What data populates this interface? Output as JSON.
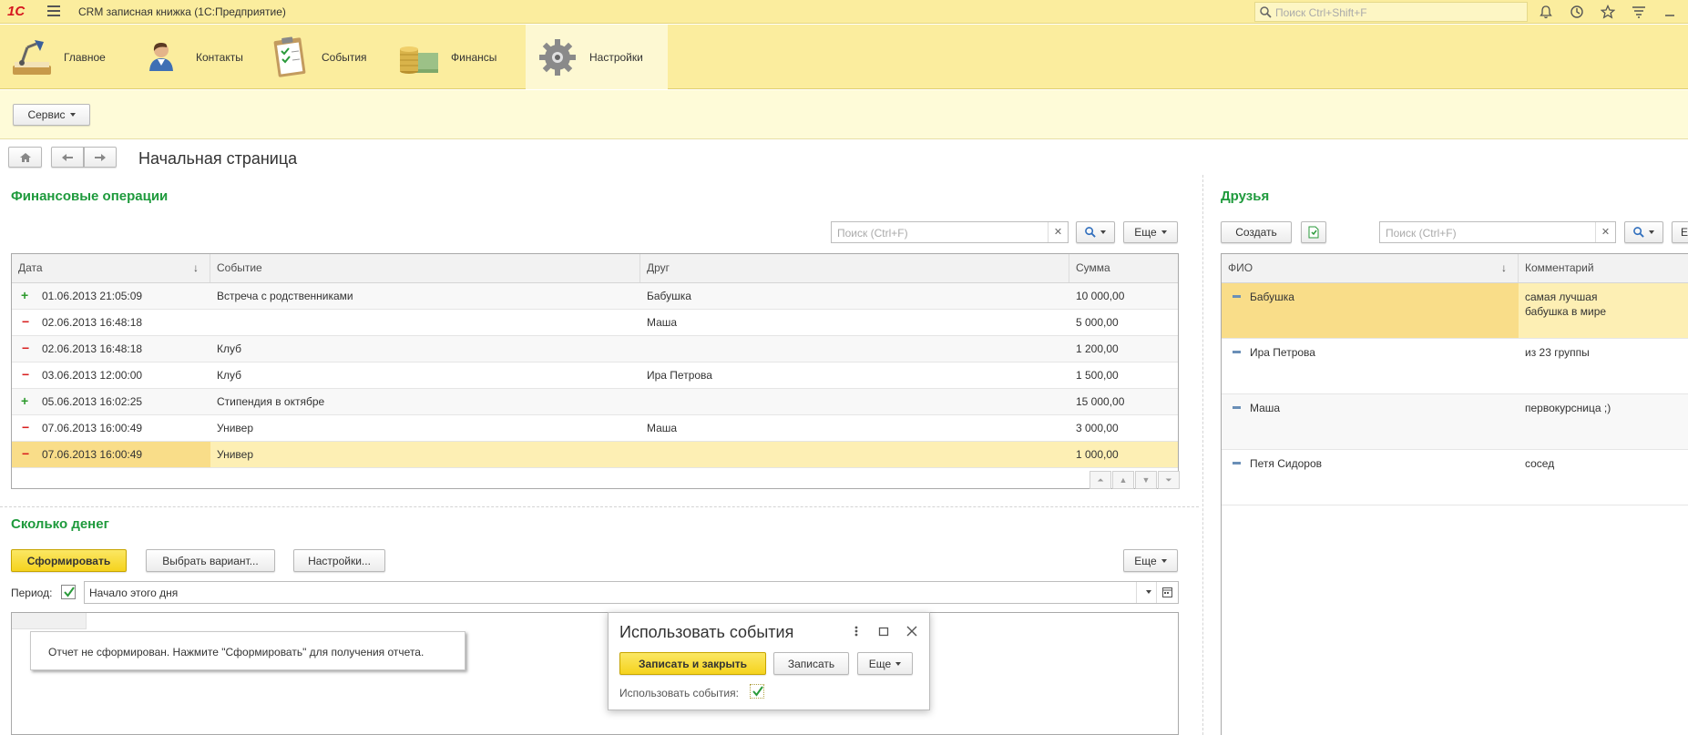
{
  "titlebar": {
    "logo": "1С",
    "title": "CRM записная книжка  (1С:Предприятие)",
    "search_placeholder": "Поиск Ctrl+Shift+F",
    "icons": [
      "bell-icon",
      "history-icon",
      "star-icon",
      "menu-lines-icon",
      "minimize-icon"
    ]
  },
  "sections": [
    {
      "label": "Главное",
      "icon": "desk-lamp-icon"
    },
    {
      "label": "Контакты",
      "icon": "person-icon"
    },
    {
      "label": "События",
      "icon": "clipboard-icon"
    },
    {
      "label": "Финансы",
      "icon": "coins-icon"
    },
    {
      "label": "Настройки",
      "icon": "gear-icon",
      "active": true
    }
  ],
  "command_bar": {
    "service_label": "Сервис"
  },
  "page": {
    "title": "Начальная страница"
  },
  "finance": {
    "title": "Финансовые операции",
    "search_placeholder": "Поиск (Ctrl+F)",
    "more_label": "Еще",
    "columns": [
      "Дата",
      "Событие",
      "Друг",
      "Сумма"
    ],
    "rows": [
      {
        "sign": "+",
        "date": "01.06.2013 21:05:09",
        "event": "Встреча с родственниками",
        "friend": "Бабушка",
        "amount": "10 000,00"
      },
      {
        "sign": "−",
        "date": "02.06.2013 16:48:18",
        "event": "",
        "friend": "Маша",
        "amount": "5 000,00"
      },
      {
        "sign": "−",
        "date": "02.06.2013 16:48:18",
        "event": "Клуб",
        "friend": "",
        "amount": "1 200,00"
      },
      {
        "sign": "−",
        "date": "03.06.2013 12:00:00",
        "event": "Клуб",
        "friend": "Ира Петрова",
        "amount": "1 500,00"
      },
      {
        "sign": "+",
        "date": "05.06.2013 16:02:25",
        "event": "Стипендия в октябре",
        "friend": "",
        "amount": "15 000,00"
      },
      {
        "sign": "−",
        "date": "07.06.2013 16:00:49",
        "event": "Универ",
        "friend": "Маша",
        "amount": "3 000,00"
      },
      {
        "sign": "−",
        "date": "07.06.2013 16:00:49",
        "event": "Универ",
        "friend": "",
        "amount": "1 000,00",
        "selected": true
      }
    ]
  },
  "money": {
    "title": "Сколько денег",
    "generate_label": "Сформировать",
    "variant_label": "Выбрать вариант...",
    "settings_label": "Настройки...",
    "more_label": "Еще",
    "period_label": "Период:",
    "period_value": "Начало этого дня",
    "report_message": "Отчет не сформирован. Нажмите \"Сформировать\" для получения отчета."
  },
  "friends": {
    "title": "Друзья",
    "create_label": "Создать",
    "search_placeholder": "Поиск (Ctrl+F)",
    "columns": [
      "ФИО",
      "Комментарий"
    ],
    "rows": [
      {
        "name": "Бабушка",
        "comment_1": "самая лучшая",
        "comment_2": "бабушка в мире",
        "selected": true
      },
      {
        "name": "Ира Петрова",
        "comment_1": "из 23 группы",
        "comment_2": ""
      },
      {
        "name": "Маша",
        "comment_1": "первокурсница ;)",
        "comment_2": ""
      },
      {
        "name": "Петя Сидоров",
        "comment_1": "сосед",
        "comment_2": ""
      }
    ]
  },
  "popup": {
    "title": "Использовать события",
    "save_close_label": "Записать и закрыть",
    "save_label": "Записать",
    "more_label": "Еще",
    "checkbox_label": "Использовать события:",
    "checked": true
  },
  "colors": {
    "accent_green": "#1e9a3c",
    "header_yellow": "#fbed9e",
    "button_yellow": "#f5d31d",
    "selected_row": "#fdefb4"
  }
}
